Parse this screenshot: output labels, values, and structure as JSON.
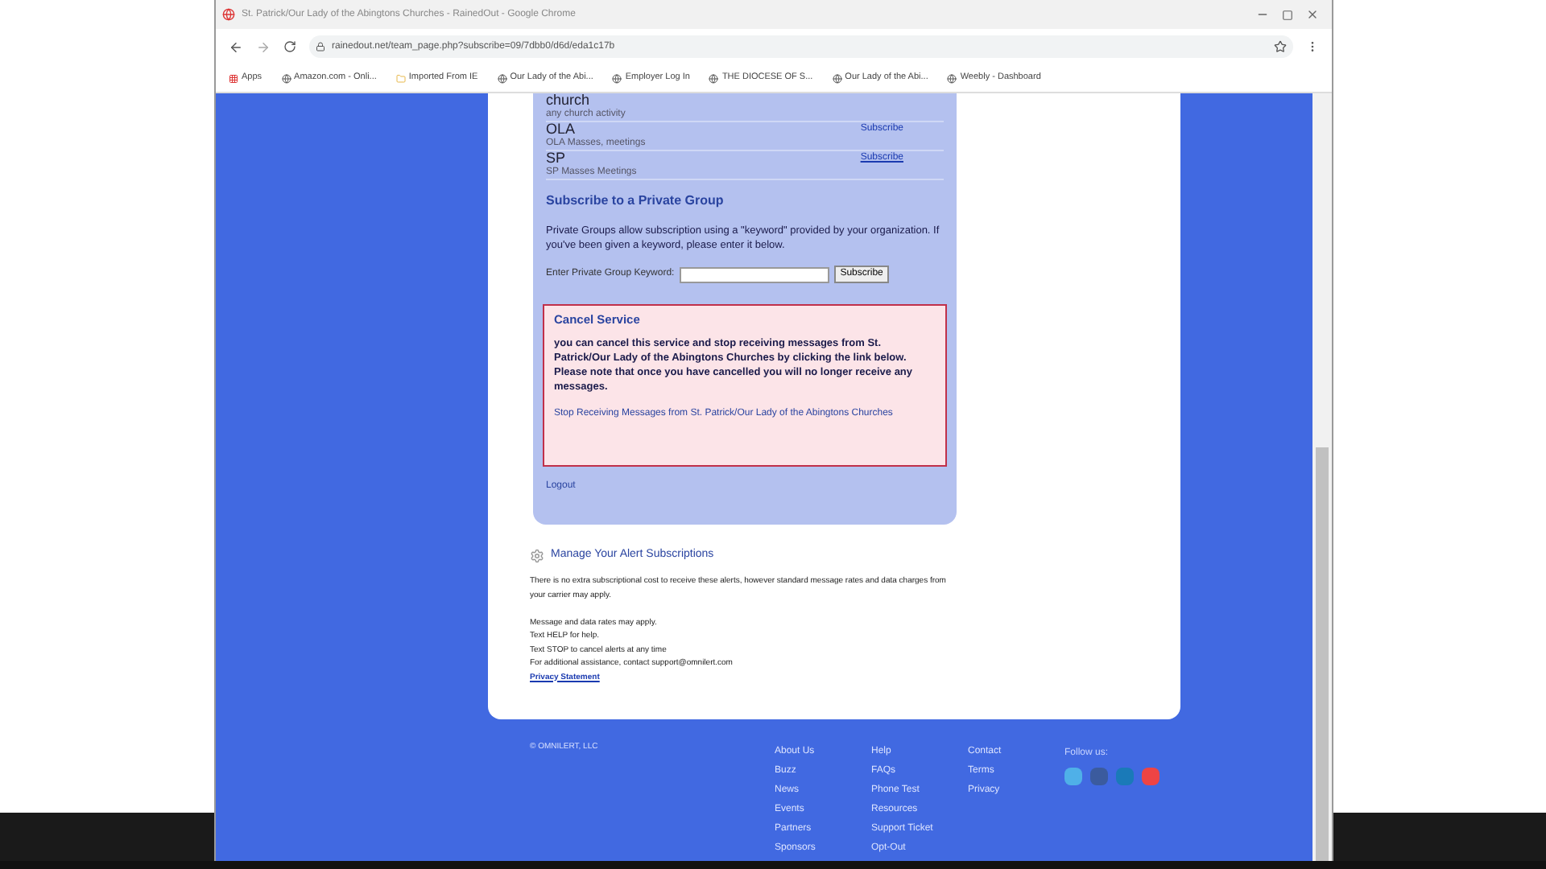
{
  "window": {
    "title": "St. Patrick/Our Lady of the Abingtons Churches - RainedOut - Google Chrome"
  },
  "address_bar": {
    "url": "rainedout.net/team_page.php?subscribe=09/7dbb0/d6d/eda1c17b"
  },
  "bookmarks": [
    "Apps",
    "Amazon.com - Onli...",
    "Imported From IE",
    "Our Lady of the Abi...",
    "Employer Log In",
    "THE DIOCESE OF S...",
    "Our Lady of the Abi...",
    "Weebly - Dashboard"
  ],
  "groups": [
    {
      "name": "church",
      "description": "any church activity"
    },
    {
      "name": "OLA",
      "description": "OLA Masses, meetings",
      "action": "Subscribe"
    },
    {
      "name": "SP",
      "description": "SP Masses Meetings",
      "action": "Subscribe"
    }
  ],
  "private_group": {
    "heading": "Subscribe to a Private Group",
    "description": "Private Groups allow subscription using a \"keyword\" provided by your organization. If you've been given a keyword, please enter it below.",
    "keyword_label": "Enter Private Group Keyword:",
    "button": "Subscribe"
  },
  "cancel_service": {
    "heading": "Cancel Service",
    "body": "you can cancel this service and stop receiving messages from St. Patrick/Our Lady of the Abingtons Churches by clicking the link below. Please note that once you have cancelled you will no longer receive any messages.",
    "link": "Stop Receiving Messages from St. Patrick/Our Lady of the Abingtons Churches"
  },
  "logout": "Logout",
  "manage": {
    "heading": "Manage Your Alert Subscriptions",
    "notice": "There is no extra subscriptional cost to receive these alerts, however standard message rates and data charges from your carrier may apply.",
    "notes": [
      "Message and data rates may apply.",
      "Text HELP for help.",
      "Text STOP to cancel alerts at any time",
      "For additional assistance, contact support@omnilert.com"
    ],
    "privacy": "Privacy Statement"
  },
  "footer": {
    "copyright": "© OMNILERT, LLC",
    "columns": [
      [
        "About Us",
        "Buzz",
        "News",
        "Events",
        "Partners",
        "Sponsors"
      ],
      [
        "Help",
        "FAQs",
        "Phone Test",
        "Resources",
        "Support Ticket",
        "Opt-Out"
      ],
      [
        "Contact",
        "Terms",
        "Privacy"
      ]
    ],
    "follow": "Follow us:"
  }
}
